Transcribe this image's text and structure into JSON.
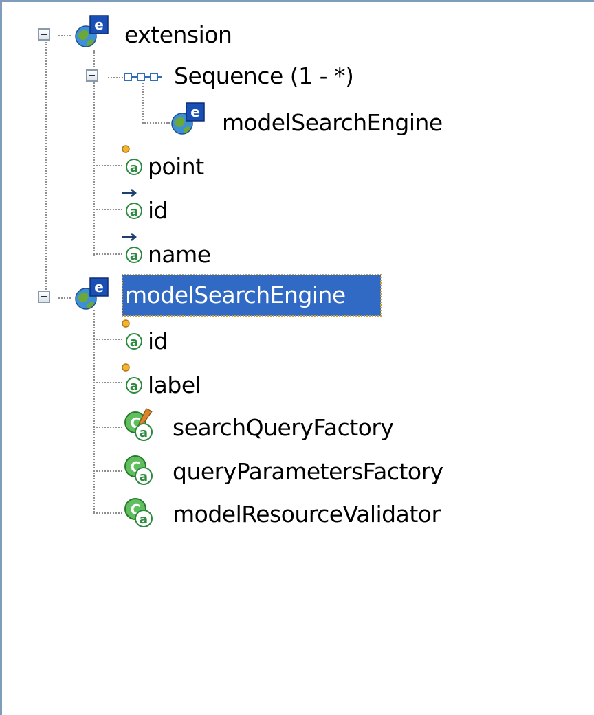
{
  "tree": {
    "extension": {
      "label": "extension",
      "icon": "element-icon"
    },
    "sequence": {
      "label": "Sequence (1 - *)",
      "icon": "sequence-icon"
    },
    "sequence_child": {
      "label": "modelSearchEngine",
      "icon": "element-icon"
    },
    "ext_attrs": [
      {
        "label": "point",
        "icon": "required-attribute-icon"
      },
      {
        "label": "id",
        "icon": "optional-attribute-icon"
      },
      {
        "label": "name",
        "icon": "optional-attribute-icon"
      }
    ],
    "model": {
      "label": "modelSearchEngine",
      "icon": "element-icon",
      "selected": true
    },
    "model_attrs": [
      {
        "label": "id",
        "icon": "required-attribute-icon"
      },
      {
        "label": "label",
        "icon": "required-attribute-icon"
      },
      {
        "label": "searchQueryFactory",
        "icon": "class-attribute-icon"
      },
      {
        "label": "queryParametersFactory",
        "icon": "class-attribute-icon"
      },
      {
        "label": "modelResourceValidator",
        "icon": "class-attribute-icon"
      }
    ]
  },
  "colors": {
    "selection": "#316ac5",
    "selection_text": "#ffffff",
    "attr_green": "#2b8a3e",
    "element_badge": "#1a4fb5"
  }
}
